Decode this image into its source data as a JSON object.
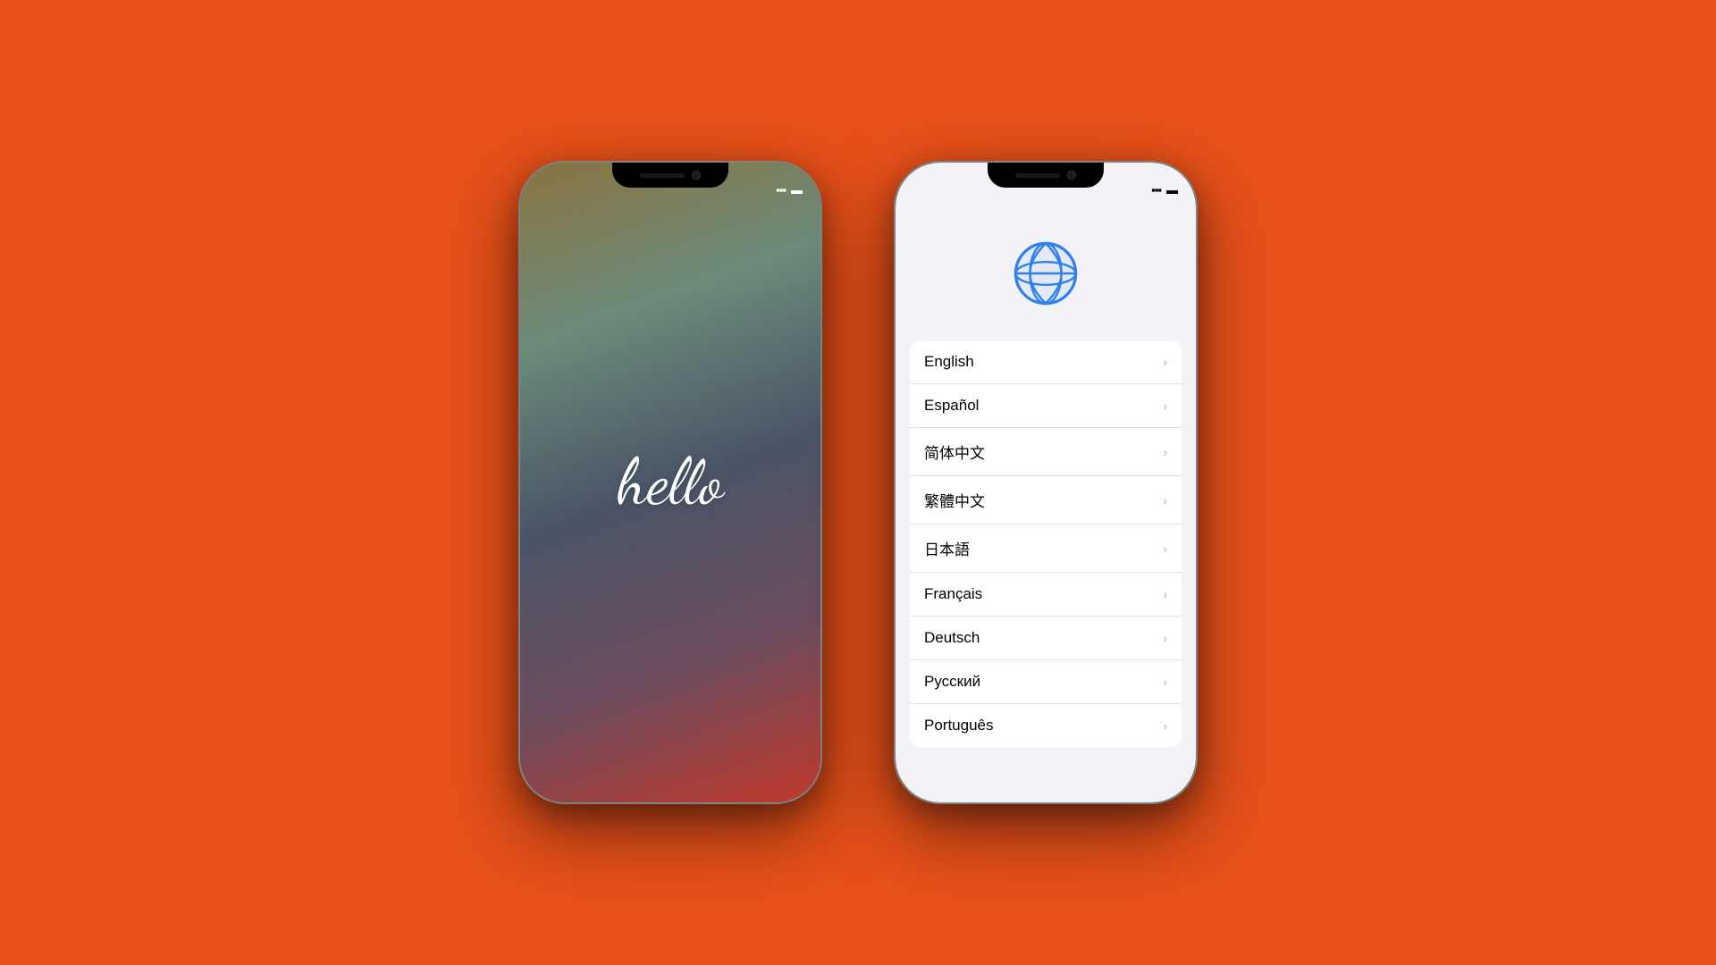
{
  "background_color": "#E8511A",
  "phone_hello": {
    "hello_text": "hello",
    "status_bar": {
      "signal": "▪▪▪",
      "battery": "🔋"
    }
  },
  "phone_lang": {
    "status_bar": {
      "signal": "▪▪▪",
      "battery": "🔋"
    },
    "globe_icon_label": "globe-icon",
    "languages": [
      {
        "name": "English",
        "chevron": "›"
      },
      {
        "name": "Español",
        "chevron": "›"
      },
      {
        "name": "简体中文",
        "chevron": "›"
      },
      {
        "name": "繁體中文",
        "chevron": "›"
      },
      {
        "name": "日本語",
        "chevron": "›"
      },
      {
        "name": "Français",
        "chevron": "›"
      },
      {
        "name": "Deutsch",
        "chevron": "›"
      },
      {
        "name": "Русский",
        "chevron": "›"
      },
      {
        "name": "Português",
        "chevron": "›"
      }
    ]
  }
}
